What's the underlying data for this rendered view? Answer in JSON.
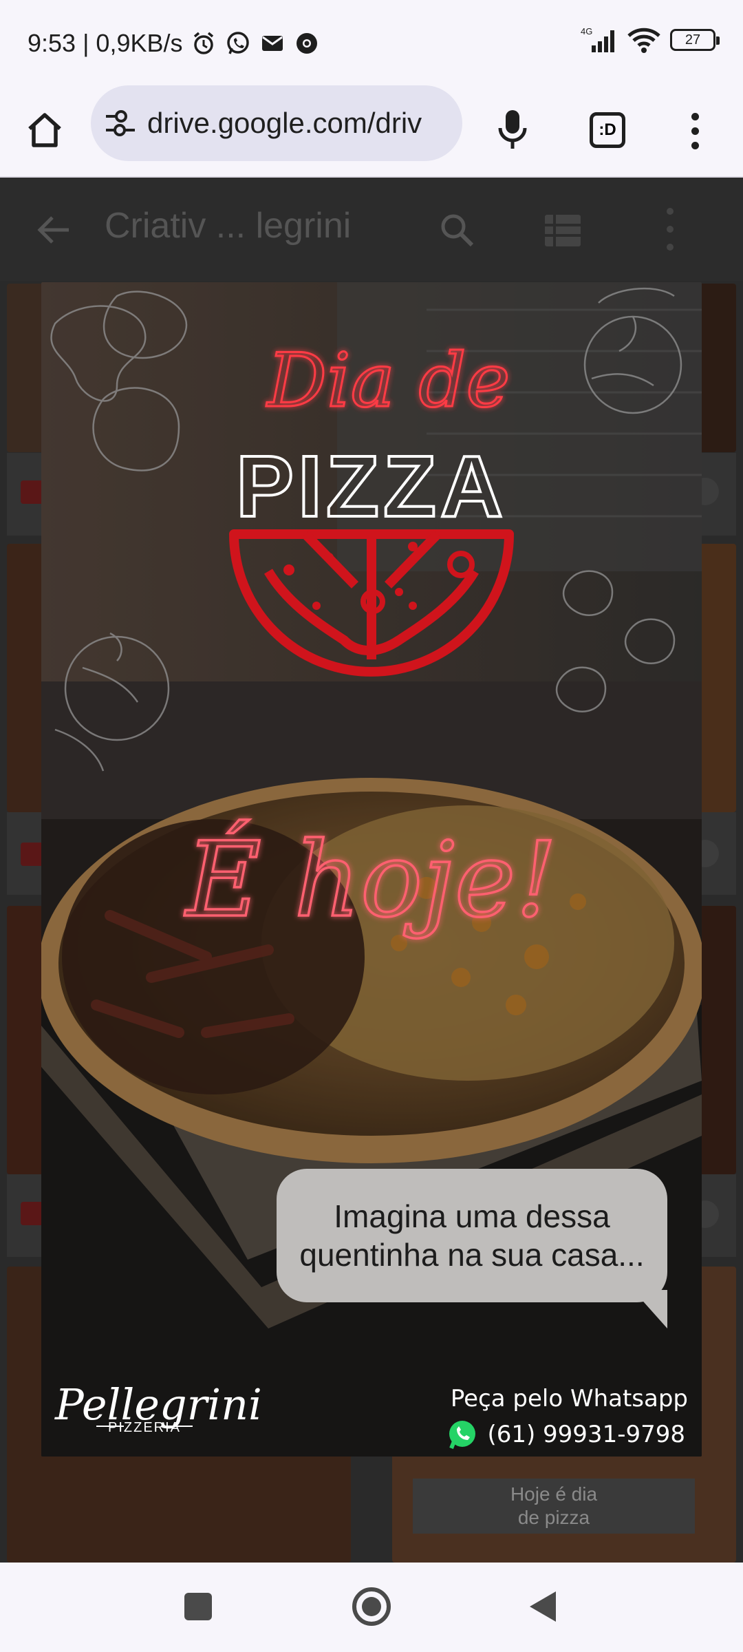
{
  "status_bar": {
    "time_speed": "9:53 | 0,9KB/s",
    "network": "4G",
    "battery": "27"
  },
  "browser": {
    "url": "drive.google.com/driv",
    "tab_switcher": ":D"
  },
  "drive": {
    "folder_title": "Criativ ... legrini",
    "caption": [
      "Hoje é dia",
      "de pizza"
    ]
  },
  "poster": {
    "headline_script": "Dia de",
    "headline_main": "PIZZA",
    "tagline_script": "É hoje!",
    "bubble": [
      "Imagina uma dessa",
      "quentinha na sua casa..."
    ],
    "cta": "Peça pelo Whatsapp",
    "phone": "(61) 99931-9798",
    "logo_name": "Pellegrini",
    "logo_sub": "PIZZERIA"
  },
  "colors": {
    "accent_red": "#d0141c",
    "neon_pink": "#ff5a6a",
    "whatsapp_green": "#25d366"
  }
}
